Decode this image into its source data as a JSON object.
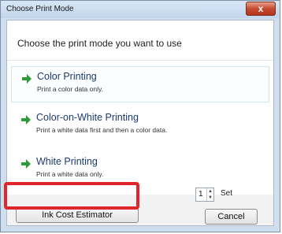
{
  "window": {
    "title": "Choose Print Mode",
    "close_label": "x"
  },
  "heading": "Choose the print mode you want to use",
  "options": [
    {
      "title": "Color Printing",
      "description": "Print a color data only."
    },
    {
      "title": "Color-on-White Printing",
      "description": "Print a white data first and then a color data."
    },
    {
      "title": "White Printing",
      "description": "Print a white data only."
    }
  ],
  "copies": {
    "value": "1",
    "label": "Set"
  },
  "buttons": {
    "ink_cost": "Ink Cost Estimator",
    "cancel": "Cancel"
  },
  "colors": {
    "accent_arrow": "#2f9a3a",
    "highlight": "#e0262a"
  }
}
